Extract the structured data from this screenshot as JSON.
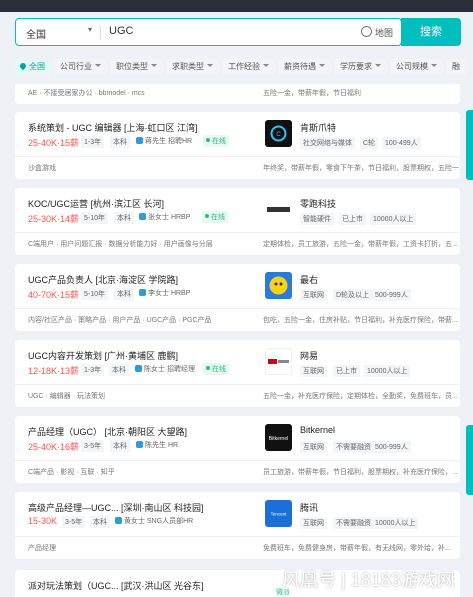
{
  "search": {
    "city": "全国",
    "query": "UGC",
    "map_label": "地图",
    "button_label": "搜索"
  },
  "filters": [
    "全国",
    "公司行业",
    "职位类型",
    "求职类型",
    "工作经验",
    "薪资待遇",
    "学历要求",
    "公司规模",
    "融"
  ],
  "partial_row": {
    "tags": "AE · 不接受居家办公 · bbmodel · mcs",
    "benefits": "五险一金，带薪年假，节日福利"
  },
  "jobs": [
    {
      "title": "系统策划 - UGC 编辑器 [上海·虹口区 江湾]",
      "salary": "25-40K·15薪",
      "experience": "1-3年",
      "education": "本科",
      "hr": "蒋先生 招聘HR",
      "online": "在线",
      "company": "肯斯爪特",
      "company_meta": [
        "社交网络与媒体",
        "C轮",
        "100-499人"
      ],
      "tags": "沙盒游戏",
      "benefits": "年终奖，带薪年假，零食下午茶，节日福利，股票期权，五险一...",
      "logo": "kenst"
    },
    {
      "title": "KOC/UGC运营 [杭州·滨江区 长河]",
      "salary": "25-30K·14薪",
      "experience": "5-10年",
      "education": "本科",
      "hr": "张女士 HRBP",
      "online": "在线",
      "company": "零跑科技",
      "company_meta": [
        "智能硬件",
        "已上市",
        "10000人以上"
      ],
      "tags": "C端用户 · 用户问题汇报 · 数据分析能力好 · 用户画像与分层",
      "benefits": "定期体检，员工旅游，五险一金，带薪年假，工资卡打折，五...",
      "logo": "leapmotor"
    },
    {
      "title": "UGC产品负责人 [北京·海淀区 学院路]",
      "salary": "40-70K·15薪",
      "experience": "5-10年",
      "education": "本科",
      "hr": "李女士 HRBP",
      "online": "",
      "company": "最右",
      "company_meta": [
        "互联网",
        "D轮及以上",
        "500-999人"
      ],
      "tags": "内容/社区产品 · 策略产品 · 用户产品 · UGC产品 · PGC产品",
      "benefits": "包吃，五险一金，住房补贴，节日福利，补充医疗保险，带薪...",
      "logo": "zuiyou"
    },
    {
      "title": "UGC内容开发策划 [广州·黄埔区 鹿鹏]",
      "salary": "12-18K·13薪",
      "experience": "1-3年",
      "education": "本科",
      "hr": "陈女士 招聘经理",
      "online": "在线",
      "company": "网易",
      "company_meta": [
        "互联网",
        "已上市",
        "10000人以上"
      ],
      "tags": "UGC · 编辑器 · 玩法策划",
      "benefits": "五险一金，补充医疗保险，定期体检，全勤奖，免费班车，员...",
      "logo": "netease"
    },
    {
      "title": "产品经理（UGC） [北京·朝阳区 大望路]",
      "salary": "25-40K·16薪",
      "experience": "3-5年",
      "education": "本科",
      "hr": "陈先生 HR",
      "online": "",
      "company": "Bitkernel",
      "company_meta": [
        "互联网",
        "不需要融资",
        "500-999人"
      ],
      "tags": "C端产品 · 影视 · 互联 · 知乎",
      "benefits": "员工旅游，带薪年假，节日福利，股票期权，补充医疗保险，...",
      "logo": "bitkernel"
    },
    {
      "title": "高级产品经理—UGC... [深圳·南山区 科技园]",
      "salary": "15-30K",
      "experience": "3-5年",
      "education": "本科",
      "hr": "黄女士 SNG人员部HR",
      "online": "",
      "company": "腾讯",
      "company_meta": [
        "互联网",
        "不需要融资",
        "10000人以上"
      ],
      "tags": "产品经理",
      "benefits": "免费班车，免费健身房，带薪年假，有无线网，零外给，补...",
      "logo": "tencent"
    },
    {
      "title": "派对玩法策划（UGC... [武汉·洪山区 光谷东]",
      "salary": "",
      "experience": "",
      "education": "",
      "hr": "",
      "online": "",
      "company": "",
      "company_meta": [
        "微派"
      ],
      "tags": "",
      "benefits": "",
      "logo": "weipai"
    }
  ],
  "watermark": "风凰号 | 18183游戏网",
  "colors": {
    "accent": "#00bebd",
    "salary": "#fe574a",
    "online": "#28c081"
  }
}
